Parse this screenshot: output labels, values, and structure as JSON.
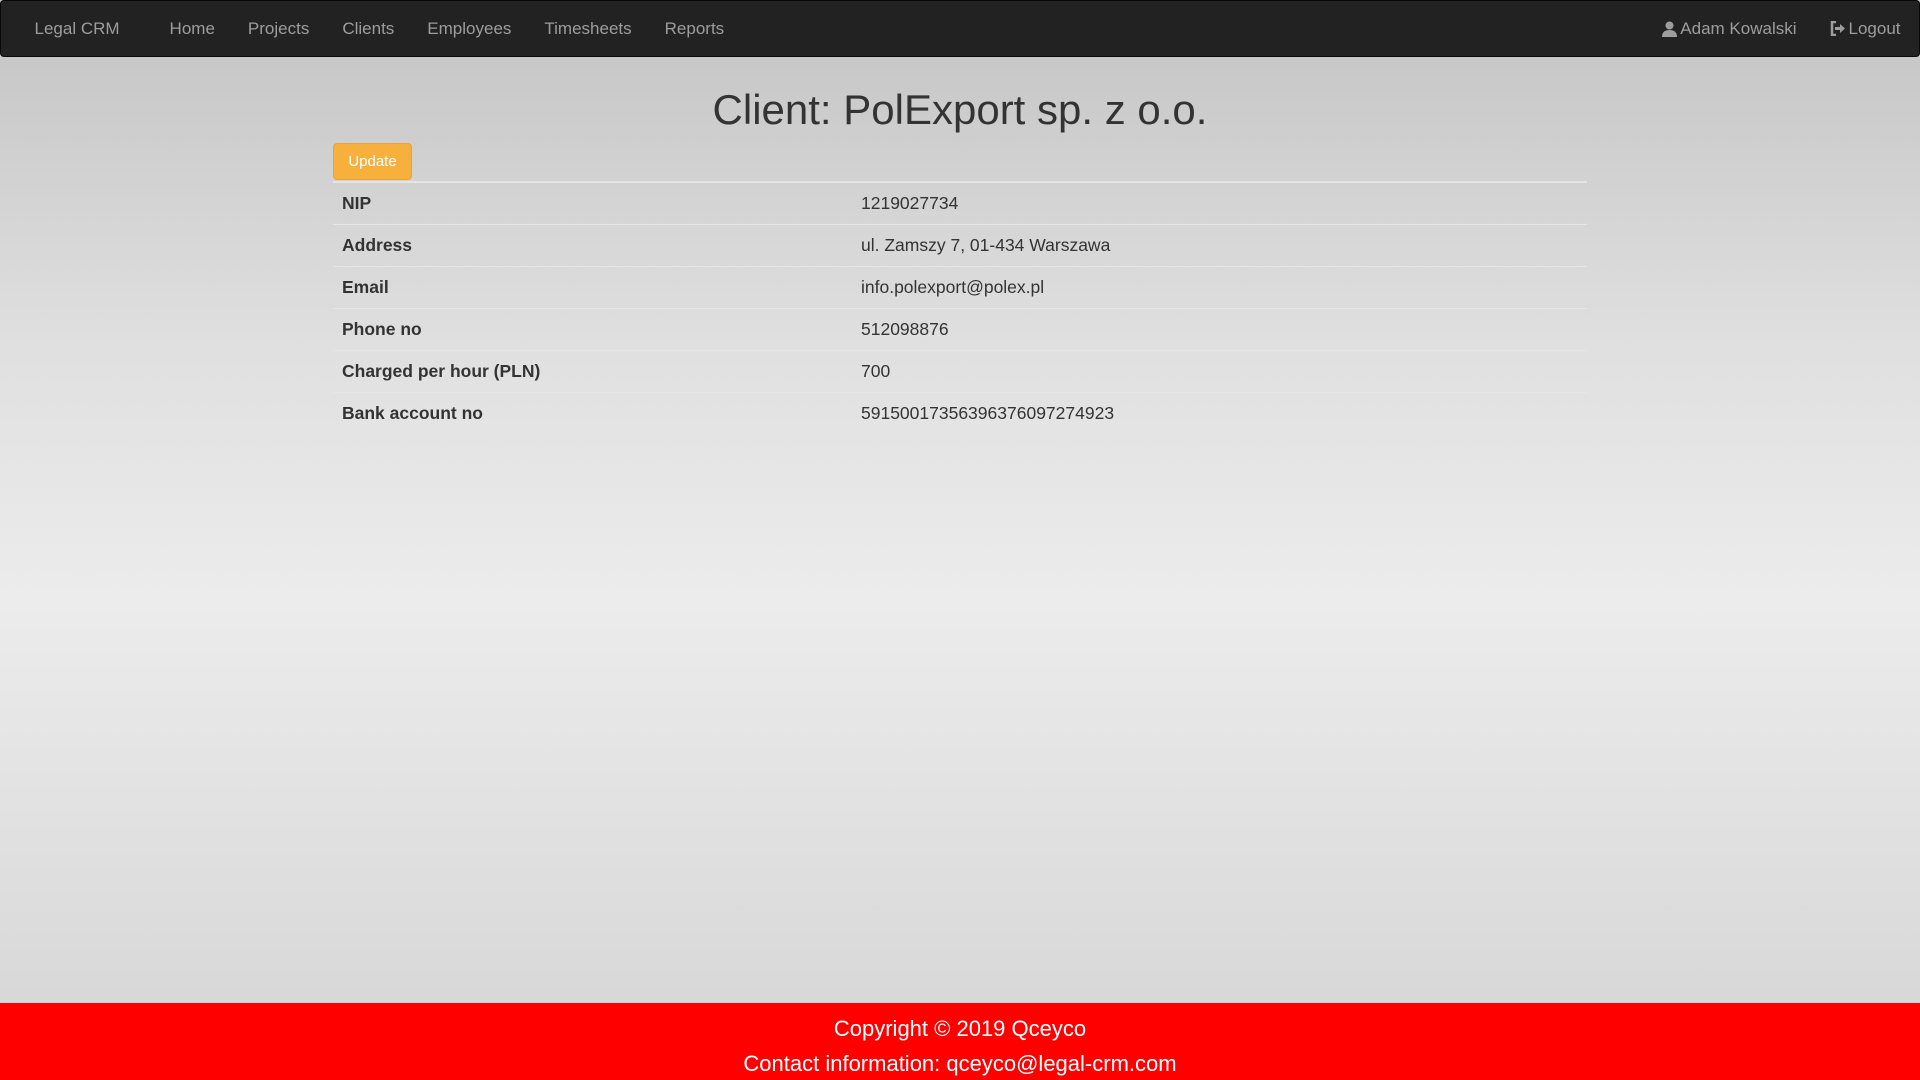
{
  "nav": {
    "brand": "Legal CRM",
    "items": [
      "Home",
      "Projects",
      "Clients",
      "Employees",
      "Timesheets",
      "Reports"
    ],
    "user": "Adam Kowalski",
    "logout": "Logout"
  },
  "title": "Client: PolExport sp. z o.o.",
  "update_label": "Update",
  "details": [
    {
      "label": "NIP",
      "value": "1219027734"
    },
    {
      "label": "Address",
      "value": "ul. Zamszy 7, 01-434 Warszawa"
    },
    {
      "label": "Email",
      "value": "info.polexport@polex.pl"
    },
    {
      "label": "Phone no",
      "value": "512098876"
    },
    {
      "label": "Charged per hour (PLN)",
      "value": "700"
    },
    {
      "label": "Bank account no",
      "value": "59150017356396376097274923"
    }
  ],
  "footer": {
    "copyright": "Copyright © 2019 Qceyco",
    "contact": "Contact information: qceyco@legal-crm.com"
  },
  "colors": {
    "update": "#f7b03c",
    "footer": "#ff0000",
    "navbar": "#222222"
  }
}
